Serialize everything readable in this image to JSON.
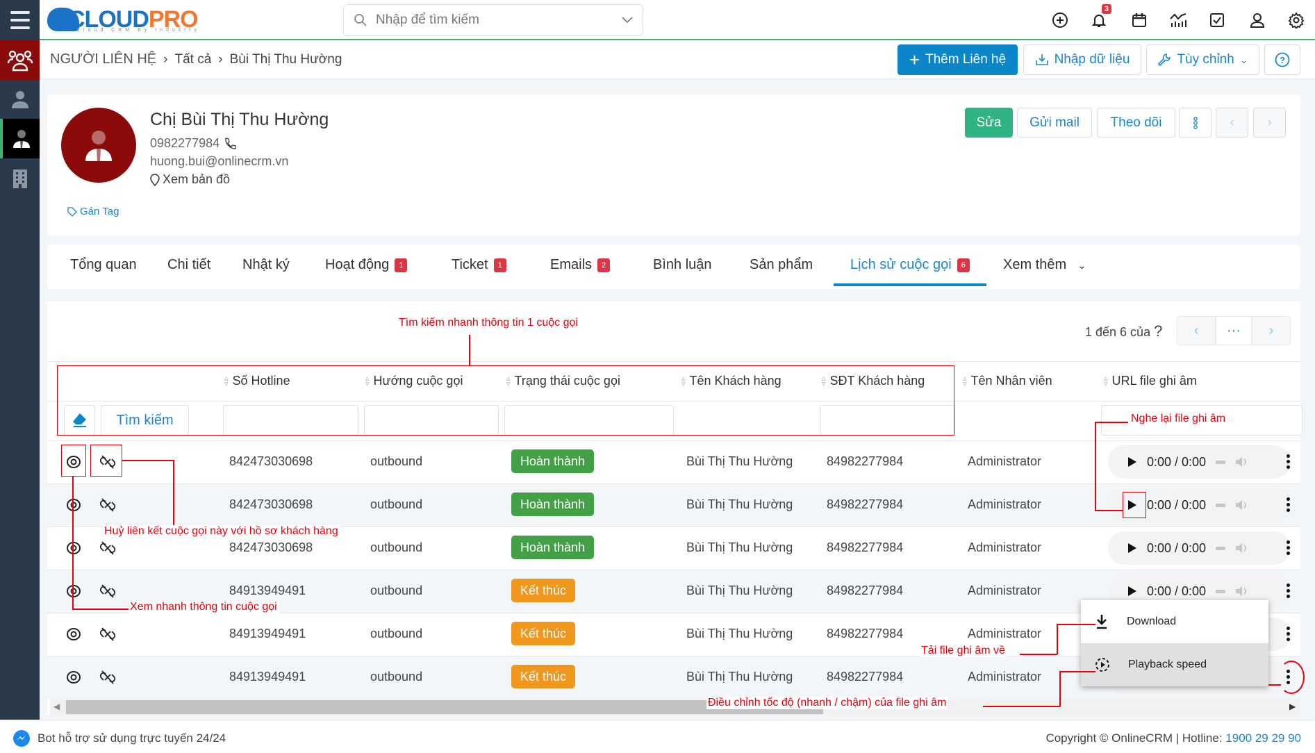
{
  "topbar": {
    "logo_text_a": "CLOUD",
    "logo_text_b": "PRO",
    "logo_tagline": "Cloud CRM By Industry",
    "search_placeholder": "Nhập để tìm kiếm",
    "notification_count": "3",
    "icons": [
      "plus-circle-icon",
      "bell-icon",
      "calendar-icon",
      "chart-icon",
      "checkbox-icon",
      "user-icon",
      "gear-icon"
    ]
  },
  "breadcrumb": {
    "module": "NGƯỜI LIÊN HỆ",
    "list": "Tất cả",
    "record": "Bùi Thị Thu Hường"
  },
  "actions": {
    "add_contact": "Thêm Liên hệ",
    "import": "Nhập dữ liệu",
    "customize": "Tùy chỉnh"
  },
  "profile": {
    "name": "Chị Bùi Thị Thu Hường",
    "phone": "0982277984",
    "email": "huong.bui@onlinecrm.vn",
    "map_link": "Xem bản đồ",
    "tag_link": "Gán Tag",
    "edit": "Sửa",
    "send_mail": "Gửi mail",
    "follow": "Theo dõi"
  },
  "tabs": [
    {
      "label": "Tổng quan",
      "count": null
    },
    {
      "label": "Chi tiết",
      "count": null
    },
    {
      "label": "Nhật ký",
      "count": null
    },
    {
      "label": "Hoạt động",
      "count": "1"
    },
    {
      "label": "Ticket",
      "count": "1"
    },
    {
      "label": "Emails",
      "count": "2"
    },
    {
      "label": "Bình luận",
      "count": null
    },
    {
      "label": "Sản phẩm",
      "count": null
    },
    {
      "label": "Lịch sử cuộc gọi",
      "count": "6",
      "active": true
    },
    {
      "label": "Xem thêm",
      "count": null
    }
  ],
  "pager": {
    "text": "1 đến 6 của",
    "total": "?",
    "more": "···"
  },
  "table": {
    "search_button": "Tìm kiếm",
    "columns": [
      "Số Hotline",
      "Hướng cuộc gọi",
      "Trạng thái cuộc gọi",
      "Tên Khách hàng",
      "SĐT Khách hàng",
      "Tên Nhân viên",
      "URL file ghi âm"
    ],
    "rows": [
      {
        "hotline": "842473030698",
        "direction": "outbound",
        "status": "Hoàn thành",
        "status_color": "#43a047",
        "customer": "Bùi Thị Thu Hường",
        "customer_phone": "84982277984",
        "agent": "Administrator",
        "audio_time": "0:00 / 0:00"
      },
      {
        "hotline": "842473030698",
        "direction": "outbound",
        "status": "Hoàn thành",
        "status_color": "#43a047",
        "customer": "Bùi Thị Thu Hường",
        "customer_phone": "84982277984",
        "agent": "Administrator",
        "audio_time": "0:00 / 0:00"
      },
      {
        "hotline": "842473030698",
        "direction": "outbound",
        "status": "Hoàn thành",
        "status_color": "#43a047",
        "customer": "Bùi Thị Thu Hường",
        "customer_phone": "84982277984",
        "agent": "Administrator",
        "audio_time": "0:00 / 0:00"
      },
      {
        "hotline": "84913949491",
        "direction": "outbound",
        "status": "Kết thúc",
        "status_color": "#f0971d",
        "customer": "Bùi Thị Thu Hường",
        "customer_phone": "84982277984",
        "agent": "Administrator",
        "audio_time": "0:00 / 0:00"
      },
      {
        "hotline": "84913949491",
        "direction": "outbound",
        "status": "Kết thúc",
        "status_color": "#f0971d",
        "customer": "Bùi Thị Thu Hường",
        "customer_phone": "84982277984",
        "agent": "Administrator",
        "audio_time": ""
      },
      {
        "hotline": "84913949491",
        "direction": "outbound",
        "status": "Kết thúc",
        "status_color": "#f0971d",
        "customer": "Bùi Thị Thu Hường",
        "customer_phone": "84982277984",
        "agent": "Administrator",
        "audio_time": ""
      }
    ]
  },
  "audio_menu": {
    "download": "Download",
    "playback_speed": "Playback speed"
  },
  "annotations": {
    "quick_search": "Tìm kiếm nhanh thông tin 1 cuộc gọi",
    "replay": "Nghe lại file ghi âm",
    "unlink": "Huỷ liên kết cuộc gọi này với hồ sơ khách hàng",
    "quick_view": "Xem nhanh thông tin cuộc gọi",
    "download": "Tải file ghi âm về",
    "speed": "Điều chỉnh tốc độ (nhanh / chậm) của file ghi âm"
  },
  "footer": {
    "bot": "Bot hỗ trợ sử dụng trực tuyến 24/24",
    "copyright": "Copyright © OnlineCRM",
    "hotline_label": "Hotline:",
    "hotline": "1900 29 29 90"
  },
  "colors": {
    "accent": "#0a86c9",
    "success": "#2fb380",
    "danger": "#dc3545",
    "sidebar": "#2b3a4a",
    "brand_red": "#8b0a0a"
  }
}
